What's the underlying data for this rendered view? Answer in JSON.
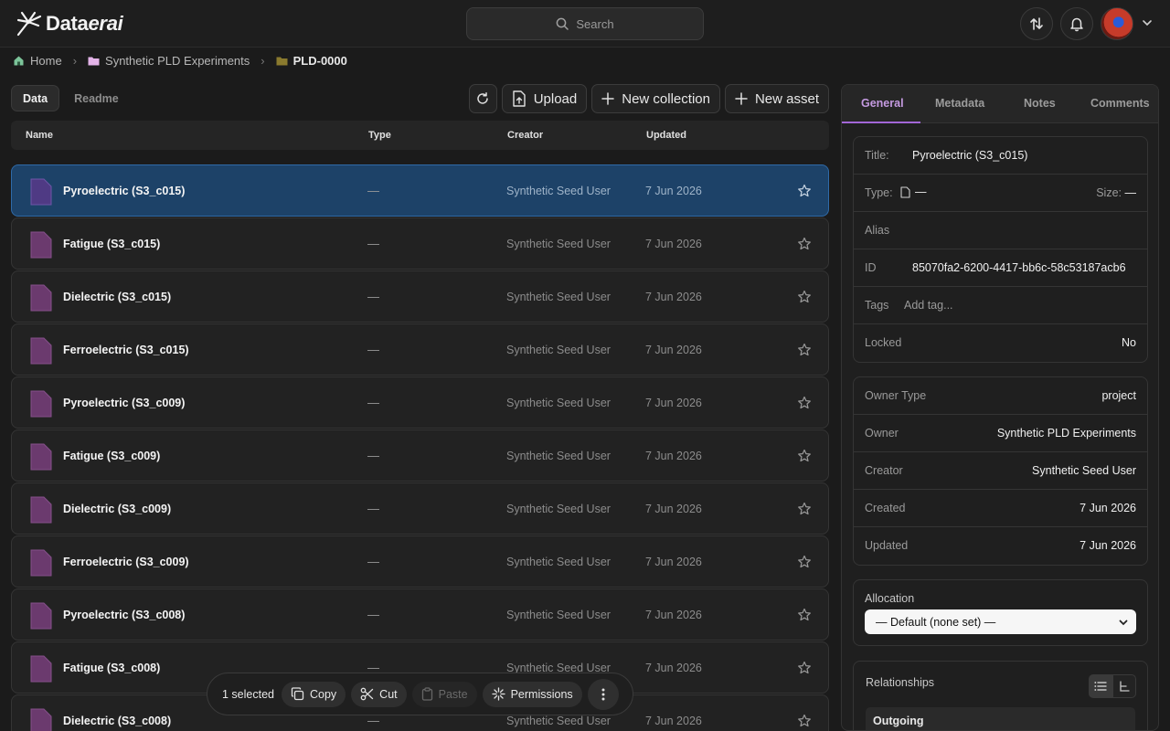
{
  "app": {
    "logo_prefix": "Data",
    "logo_suffix": "erai",
    "search_placeholder": "Search"
  },
  "breadcrumb": [
    {
      "label": "Home",
      "icon": "home-icon"
    },
    {
      "label": "Synthetic PLD Experiments",
      "icon": "folder-icon"
    },
    {
      "label": "PLD-0000",
      "icon": "folder-icon"
    }
  ],
  "view_tabs": {
    "data": "Data",
    "readme": "Readme",
    "active": "data"
  },
  "toolbar": {
    "upload": "Upload",
    "new_collection": "New collection",
    "new_asset": "New asset"
  },
  "table": {
    "columns": {
      "name": "Name",
      "type": "Type",
      "creator": "Creator",
      "updated": "Updated"
    },
    "rows": [
      {
        "name": "Pyroelectric (S3_c015)",
        "type": "—",
        "creator": "Synthetic Seed User",
        "updated": "7 Jun 2026",
        "selected": true
      },
      {
        "name": "Fatigue (S3_c015)",
        "type": "—",
        "creator": "Synthetic Seed User",
        "updated": "7 Jun 2026"
      },
      {
        "name": "Dielectric (S3_c015)",
        "type": "—",
        "creator": "Synthetic Seed User",
        "updated": "7 Jun 2026"
      },
      {
        "name": "Ferroelectric (S3_c015)",
        "type": "—",
        "creator": "Synthetic Seed User",
        "updated": "7 Jun 2026"
      },
      {
        "name": "Pyroelectric (S3_c009)",
        "type": "—",
        "creator": "Synthetic Seed User",
        "updated": "7 Jun 2026"
      },
      {
        "name": "Fatigue (S3_c009)",
        "type": "—",
        "creator": "Synthetic Seed User",
        "updated": "7 Jun 2026"
      },
      {
        "name": "Dielectric (S3_c009)",
        "type": "—",
        "creator": "Synthetic Seed User",
        "updated": "7 Jun 2026"
      },
      {
        "name": "Ferroelectric (S3_c009)",
        "type": "—",
        "creator": "Synthetic Seed User",
        "updated": "7 Jun 2026"
      },
      {
        "name": "Pyroelectric (S3_c008)",
        "type": "—",
        "creator": "Synthetic Seed User",
        "updated": "7 Jun 2026"
      },
      {
        "name": "Fatigue (S3_c008)",
        "type": "—",
        "creator": "Synthetic Seed User",
        "updated": "7 Jun 2026"
      },
      {
        "name": "Dielectric (S3_c008)",
        "type": "—",
        "creator": "Synthetic Seed User",
        "updated": "7 Jun 2026"
      }
    ]
  },
  "selection_bar": {
    "count": "1 selected",
    "copy": "Copy",
    "cut": "Cut",
    "paste": "Paste",
    "permissions": "Permissions"
  },
  "panel": {
    "tabs": {
      "general": "General",
      "metadata": "Metadata",
      "notes": "Notes",
      "comments": "Comments",
      "active": "general"
    },
    "info": {
      "title_label": "Title:",
      "title_value": "Pyroelectric (S3_c015)",
      "type_label": "Type:",
      "type_value": "—",
      "size_label": "Size:",
      "size_value": "—",
      "alias_label": "Alias",
      "id_label": "ID",
      "id_value": "85070fa2-6200-4417-bb6c-58c53187acb6",
      "tags_label": "Tags",
      "tags_placeholder": "Add tag...",
      "locked_label": "Locked",
      "locked_value": "No"
    },
    "ownership": {
      "owner_type_label": "Owner Type",
      "owner_type_value": "project",
      "owner_label": "Owner",
      "owner_value": "Synthetic PLD Experiments",
      "creator_label": "Creator",
      "creator_value": "Synthetic Seed User",
      "created_label": "Created",
      "created_value": "7 Jun 2026",
      "updated_label": "Updated",
      "updated_value": "7 Jun 2026"
    },
    "allocation": {
      "label": "Allocation",
      "selected": "— Default (none set) —"
    },
    "relationships": {
      "label": "Relationships",
      "outgoing": "Outgoing"
    }
  },
  "colors": {
    "accent": "#a266d6",
    "selected_row": "#1d4268",
    "file_icon": "#6b3a6e"
  }
}
